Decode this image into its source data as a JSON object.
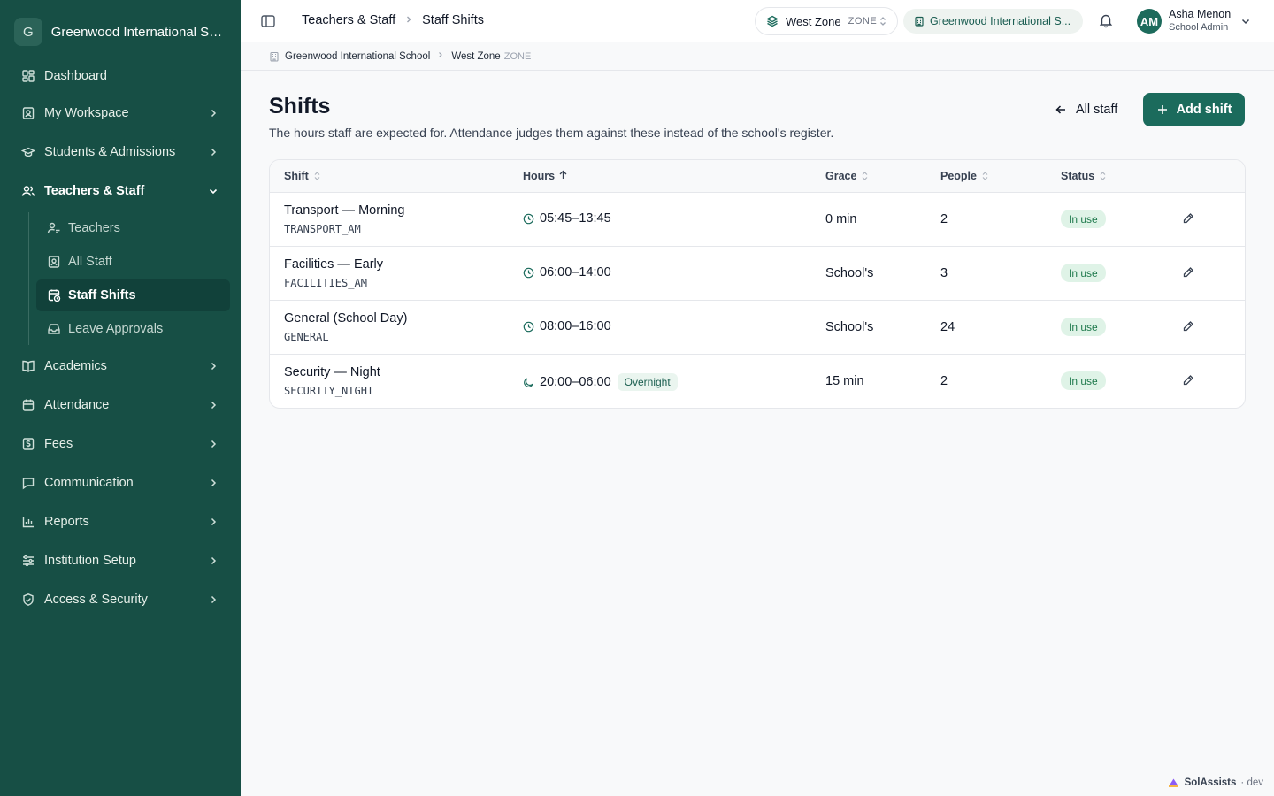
{
  "sidebar": {
    "org_initial": "G",
    "org_name": "Greenwood International Sc...",
    "items": [
      {
        "label": "Dashboard",
        "icon": "dashboard-icon"
      },
      {
        "label": "My Workspace",
        "icon": "workspace-icon"
      },
      {
        "label": "Students & Admissions",
        "icon": "graduation-cap-icon"
      },
      {
        "label": "Teachers & Staff",
        "icon": "users-icon"
      },
      {
        "label": "Academics",
        "icon": "book-icon"
      },
      {
        "label": "Attendance",
        "icon": "calendar-icon"
      },
      {
        "label": "Fees",
        "icon": "receipt-icon"
      },
      {
        "label": "Communication",
        "icon": "message-icon"
      },
      {
        "label": "Reports",
        "icon": "bar-chart-icon"
      },
      {
        "label": "Institution Setup",
        "icon": "sliders-icon"
      },
      {
        "label": "Access & Security",
        "icon": "shield-icon"
      }
    ],
    "sub_items": [
      {
        "label": "Teachers",
        "icon": "teacher-icon"
      },
      {
        "label": "All Staff",
        "icon": "badge-icon"
      },
      {
        "label": "Staff Shifts",
        "icon": "calendar-clock-icon"
      },
      {
        "label": "Leave Approvals",
        "icon": "inbox-icon"
      }
    ]
  },
  "topbar": {
    "crumb_parent": "Teachers & Staff",
    "crumb_current": "Staff Shifts",
    "zone_name": "West Zone",
    "zone_tag": "ZONE",
    "school_name": "Greenwood International S...",
    "user_initials": "AM",
    "user_name": "Asha Menon",
    "user_role": "School Admin"
  },
  "subbar": {
    "school": "Greenwood International School",
    "zone": "West Zone",
    "zone_tag": "ZONE"
  },
  "page": {
    "title": "Shifts",
    "description": "The hours staff are expected for. Attendance judges them against these instead of the school's register.",
    "back_label": "All staff",
    "add_label": "Add shift"
  },
  "table": {
    "headers": {
      "shift": "Shift",
      "hours": "Hours",
      "grace": "Grace",
      "people": "People",
      "status": "Status"
    },
    "rows": [
      {
        "name": "Transport — Morning",
        "code": "TRANSPORT_AM",
        "hours": "05:45–13:45",
        "hours_icon": "clock-icon",
        "overnight": "",
        "grace": "0 min",
        "people": "2",
        "status": "In use"
      },
      {
        "name": "Facilities — Early",
        "code": "FACILITIES_AM",
        "hours": "06:00–14:00",
        "hours_icon": "clock-icon",
        "overnight": "",
        "grace": "School's",
        "people": "3",
        "status": "In use"
      },
      {
        "name": "General (School Day)",
        "code": "GENERAL",
        "hours": "08:00–16:00",
        "hours_icon": "clock-icon",
        "overnight": "",
        "grace": "School's",
        "people": "24",
        "status": "In use"
      },
      {
        "name": "Security — Night",
        "code": "SECURITY_NIGHT",
        "hours": "20:00–06:00",
        "hours_icon": "moon-icon",
        "overnight": "Overnight",
        "grace": "15 min",
        "people": "2",
        "status": "In use"
      }
    ]
  },
  "footer": {
    "brand": "SolAssists",
    "env": "· dev"
  },
  "colors": {
    "sidebar": "#174f45",
    "accent": "#1b6b5c",
    "status_bg": "#dff3e7",
    "status_text": "#1f7a4d"
  }
}
